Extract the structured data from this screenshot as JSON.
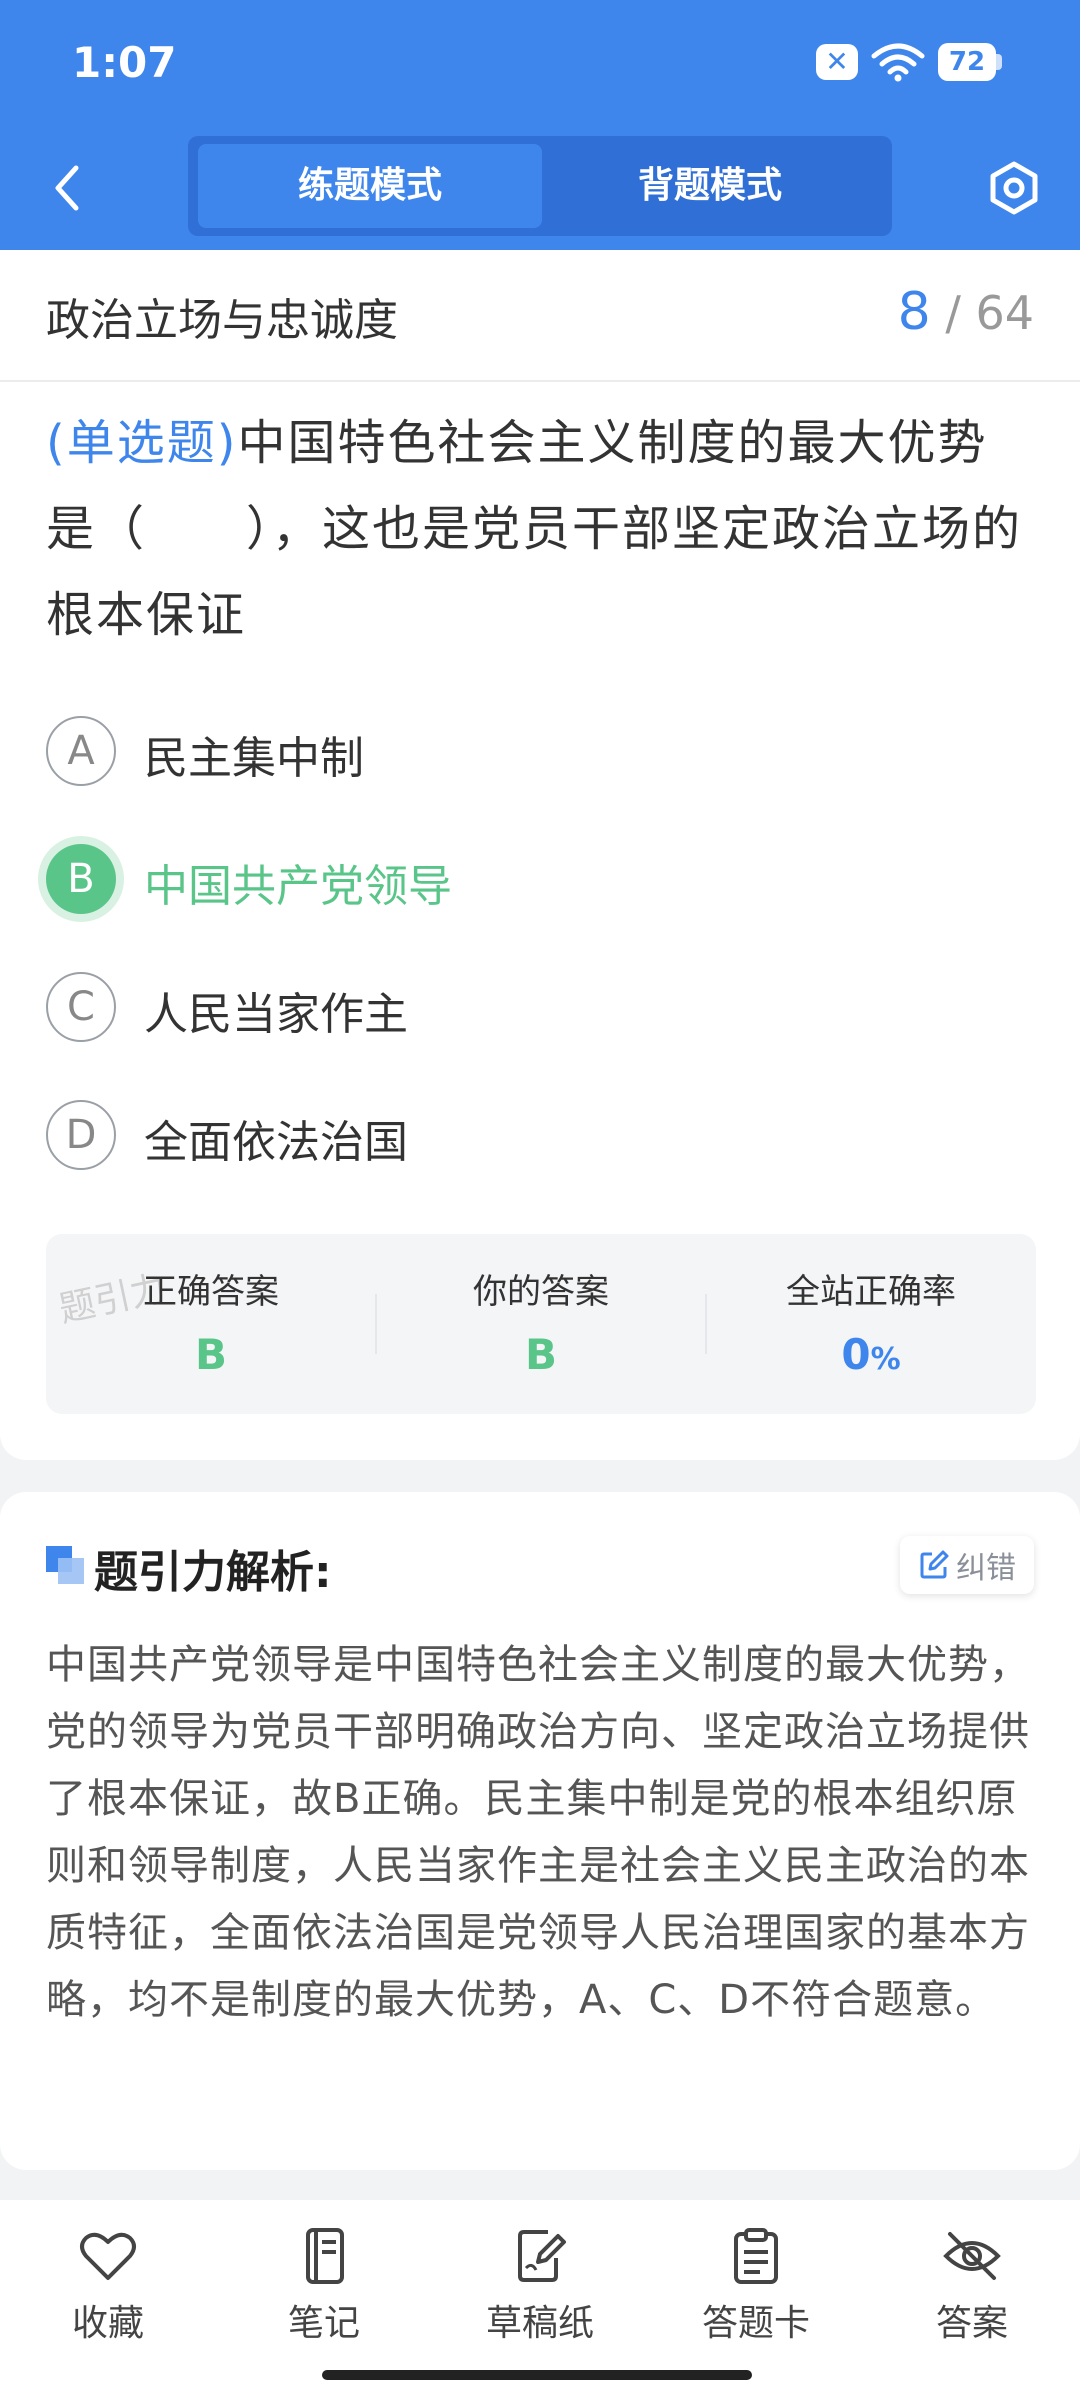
{
  "status": {
    "time": "1:07",
    "battery": "72"
  },
  "nav": {
    "tabs": [
      "练题模式",
      "背题模式"
    ]
  },
  "section": {
    "title": "政治立场与忠诚度",
    "current": "8",
    "total": "/ 64"
  },
  "question": {
    "type": "(单选题)",
    "text": "中国特色社会主义制度的最大优势是（　　），这也是党员干部坚定政治立场的根本保证"
  },
  "options": [
    {
      "letter": "A",
      "text": "民主集中制"
    },
    {
      "letter": "B",
      "text": "中国共产党领导"
    },
    {
      "letter": "C",
      "text": "人民当家作主"
    },
    {
      "letter": "D",
      "text": "全面依法治国"
    }
  ],
  "answer": {
    "watermark": "题引力",
    "correct_label": "正确答案",
    "correct_value": "B",
    "yours_label": "你的答案",
    "yours_value": "B",
    "rate_label": "全站正确率",
    "rate_value": "0",
    "rate_unit": "%"
  },
  "analysis": {
    "title": "题引力解析:",
    "correct_btn": "纠错",
    "text": "中国共产党领导是中国特色社会主义制度的最大优势，党的领导为党员干部明确政治方向、坚定政治立场提供了根本保证，故B正确。民主集中制是党的根本组织原则和领导制度，人民当家作主是社会主义民主政治的本质特征，全面依法治国是党领导人民治理国家的基本方略，均不是制度的最大优势，A、C、D不符合题意。"
  },
  "toolbar": [
    "收藏",
    "笔记",
    "草稿纸",
    "答题卡",
    "答案"
  ],
  "colors": {
    "primary": "#3f86ec",
    "correct": "#5ac589"
  }
}
